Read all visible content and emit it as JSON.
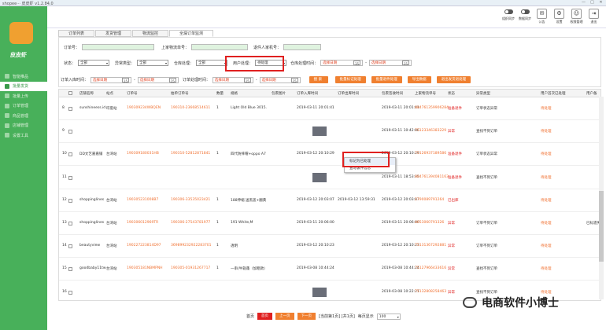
{
  "window": {
    "title": "shopee··· 皮皮虾 v1.2.84.0"
  },
  "sidebar": {
    "brand": "皮皮虾",
    "items": [
      {
        "label": "智能推品",
        "active": false
      },
      {
        "label": "批量发货",
        "active": true
      },
      {
        "label": "批量上传",
        "active": false
      },
      {
        "label": "订单管理",
        "active": false
      },
      {
        "label": "商品管理",
        "active": false
      },
      {
        "label": "店铺管理",
        "active": false
      },
      {
        "label": "设置工具",
        "active": false
      }
    ]
  },
  "topbar": {
    "toggles": [
      "组织同步",
      "数据同步"
    ],
    "icons": [
      {
        "name": "notice-icon",
        "label": "公告"
      },
      {
        "name": "settings-icon",
        "label": "设置"
      },
      {
        "name": "account-icon",
        "label": "权限管理"
      },
      {
        "name": "logout-icon",
        "label": "退出"
      }
    ]
  },
  "tabs": [
    "订单列表",
    "发货管理",
    "物流监控",
    "全漏订单监测"
  ],
  "filters": {
    "order_no_label": "订单号：",
    "upload_no_label": "上家物流单号：",
    "buyer_label": "退件人家机号：",
    "status_label": "状态：",
    "status_value": "全部",
    "exception_label": "异常类型：",
    "exception_value": "全部",
    "warehouse_label": "仓库处理：",
    "warehouse_value": "全部",
    "user_process_label": "用户处理：",
    "user_process_value": "待处理",
    "storage_time_label": "仓库处理时间：",
    "date_placeholder": "选择日期",
    "order_time_label": "订单入库时间：",
    "user_time_label": "订单处理时间：",
    "buttons": [
      "搜 索",
      "批量标记处理",
      "批量退件处理",
      "导出数据",
      "退出发货退处理"
    ]
  },
  "table": {
    "headers": [
      "店铺名称",
      "站点",
      "订单号",
      "拍单订单号",
      "数量",
      "规格",
      "包裹图片",
      "订单入库时间",
      "订单出库时间",
      "包裹签收时间",
      "上家物流单号",
      "状态",
      "异常类型",
      "用户首次已处理",
      "用户备"
    ],
    "rows": [
      {
        "no": "8",
        "shop": "sunshineess.id",
        "site": "印度站",
        "order": "190309234WBQEN",
        "pai": "190310-23668514611",
        "qty": "1",
        "spec": "Light Old Blue 3015.",
        "thumb": false,
        "in_time": "2019-03-11 20:01:41",
        "out_time": "",
        "sign_time": "2019-03-11 20:01:41",
        "ship_no": "884761359906284",
        "status": "准备退件",
        "type": "订单状态异常",
        "user": "待处理",
        "extra": ""
      },
      {
        "no": "9",
        "shop": "",
        "site": "",
        "order": "",
        "pai": "",
        "qty": "",
        "spec": "",
        "thumb": true,
        "in_time": "",
        "out_time": "",
        "sign_time": "2019-03-11 10:42:06",
        "ship_no": "75123346383229",
        "status": "异常",
        "type": "查找不到订单",
        "user": "待处理",
        "extra": ""
      },
      {
        "no": "10",
        "shop": "DD文艺嘉嘉铺",
        "site": "台湾站",
        "order": "190309180031HB",
        "pai": "190310-52812871841",
        "qty": "1",
        "spec": "四代防摔帽+oppo A7",
        "thumb": false,
        "in_time": "2019-03-12 20:10:29",
        "out_time": "",
        "sign_time": "2019-03-12 20:10:29",
        "ship_no": "75126937189586",
        "status": "准备退件",
        "type": "订单状态异常",
        "user": "待处理",
        "extra": ""
      },
      {
        "no": "11",
        "shop": "",
        "site": "",
        "order": "",
        "pai": "",
        "qty": "",
        "spec": "",
        "thumb": true,
        "in_time": "",
        "out_time": "",
        "sign_time": "2019-03-11 18:53:05",
        "ship_no": "884761394081163",
        "status": "准备退件",
        "type": "查找不到订单",
        "user": "待处理",
        "extra": ""
      },
      {
        "no": "12",
        "shop": "shoppinglines",
        "site": "台湾站",
        "order": "190305231008B7",
        "pai": "190306-33535023421",
        "qty": "1",
        "spec": "188伸缩 送黑盖+翻黄",
        "thumb": false,
        "in_time": "2019-03-12 20:03:07",
        "out_time": "2019-03-12 13:59:31",
        "sign_time": "2019-03-12 20:03:07",
        "ship_no": "2790089791264",
        "status": "已出库",
        "type": "",
        "user": "待处理",
        "extra": ""
      },
      {
        "no": "13",
        "shop": "shoppinglines",
        "site": "台湾站",
        "order": "190306012969TR",
        "pai": "190306-27543781977",
        "qty": "1",
        "spec": "191 White,M",
        "thumb": false,
        "in_time": "2019-03-11 20:06:00",
        "out_time": "",
        "sign_time": "2019-03-11 20:06:00",
        "ship_no": "4653060791326",
        "status": "异常",
        "type": "订单不到订单",
        "user": "待处理",
        "extra": "已标遗失"
      },
      {
        "no": "14",
        "shop": "beautyview",
        "site": "台湾站",
        "order": "190227223814D97",
        "pai": "369899232922283701",
        "qty": "1",
        "spec": "透明",
        "thumb": false,
        "in_time": "2019-03-12 20:10:23",
        "out_time": "",
        "sign_time": "2019-03-12 20:10:23",
        "ship_no": "75131367292881",
        "status": "异常",
        "type": "订单不到订单",
        "user": "待处理",
        "extra": ""
      },
      {
        "no": "15",
        "shop": "goodbaby11tw",
        "site": "台湾站",
        "order": "190305181NBMPNH",
        "pai": "190305-01931267717",
        "qty": "1",
        "spec": "一串(牛轭蓬（加粗款）",
        "thumb": false,
        "in_time": "2019-03-08 10:44:24",
        "out_time": "",
        "sign_time": "2019-03-08 10:44:24",
        "ship_no": "75127966433616",
        "status": "异常",
        "type": "查找不到订单",
        "user": "待处理",
        "extra": ""
      },
      {
        "no": "16",
        "shop": "",
        "site": "",
        "order": "",
        "pai": "",
        "qty": "",
        "spec": "",
        "thumb": true,
        "in_time": "",
        "out_time": "",
        "sign_time": "2019-03-08 10:22:27",
        "ship_no": "75132808258463",
        "status": "异常",
        "type": "查找不到订单",
        "user": "待处理",
        "extra": ""
      }
    ]
  },
  "context_menu": [
    "标记为已处理",
    "查与该件信息"
  ],
  "pager": {
    "first": "首页",
    "prev": "上一页",
    "next": "下一页",
    "info": "[当前第1页] [共1页]",
    "per_page_label": "每页显示",
    "per_page": "100"
  },
  "watermark": "电商软件小博士"
}
